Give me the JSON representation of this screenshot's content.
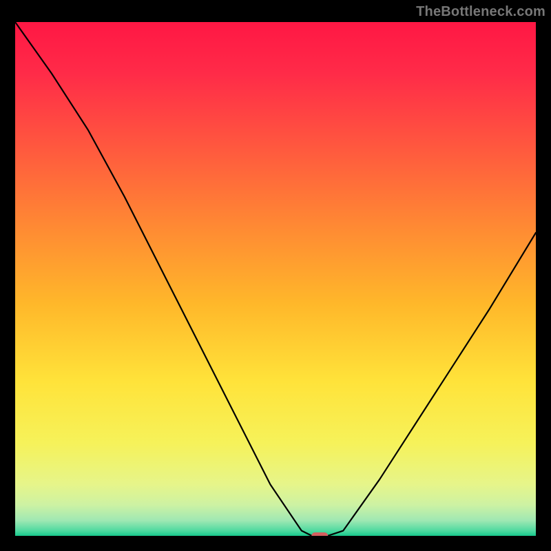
{
  "attribution": "TheBottleneck.com",
  "chart_data": {
    "type": "line",
    "title": "",
    "xlabel": "",
    "ylabel": "",
    "xlim": [
      0,
      1
    ],
    "ylim": [
      0,
      100
    ],
    "x": [
      0.0,
      0.07,
      0.14,
      0.21,
      0.28,
      0.35,
      0.42,
      0.49,
      0.55,
      0.57,
      0.6,
      0.63,
      0.7,
      0.77,
      0.84,
      0.91,
      1.0
    ],
    "values": [
      100,
      90,
      79,
      66,
      52,
      38,
      24,
      10,
      1,
      0,
      0,
      1,
      11,
      22,
      33,
      44,
      59
    ],
    "flat_segment": {
      "x_start": 0.57,
      "x_end": 0.6,
      "value": 0
    },
    "marker": {
      "x": 0.585,
      "y": 0,
      "kind": "pill",
      "color": "#d35f5f"
    },
    "gradient_stops": [
      {
        "offset": 0.0,
        "color": "#ff1744"
      },
      {
        "offset": 0.1,
        "color": "#ff2b48"
      },
      {
        "offset": 0.25,
        "color": "#ff5a3e"
      },
      {
        "offset": 0.4,
        "color": "#ff8a33"
      },
      {
        "offset": 0.55,
        "color": "#ffb82a"
      },
      {
        "offset": 0.7,
        "color": "#ffe33a"
      },
      {
        "offset": 0.82,
        "color": "#f6f25a"
      },
      {
        "offset": 0.9,
        "color": "#e6f58a"
      },
      {
        "offset": 0.94,
        "color": "#cdf2a3"
      },
      {
        "offset": 0.97,
        "color": "#9fe8b3"
      },
      {
        "offset": 0.99,
        "color": "#4fd9a0"
      },
      {
        "offset": 1.0,
        "color": "#17c98c"
      }
    ]
  }
}
